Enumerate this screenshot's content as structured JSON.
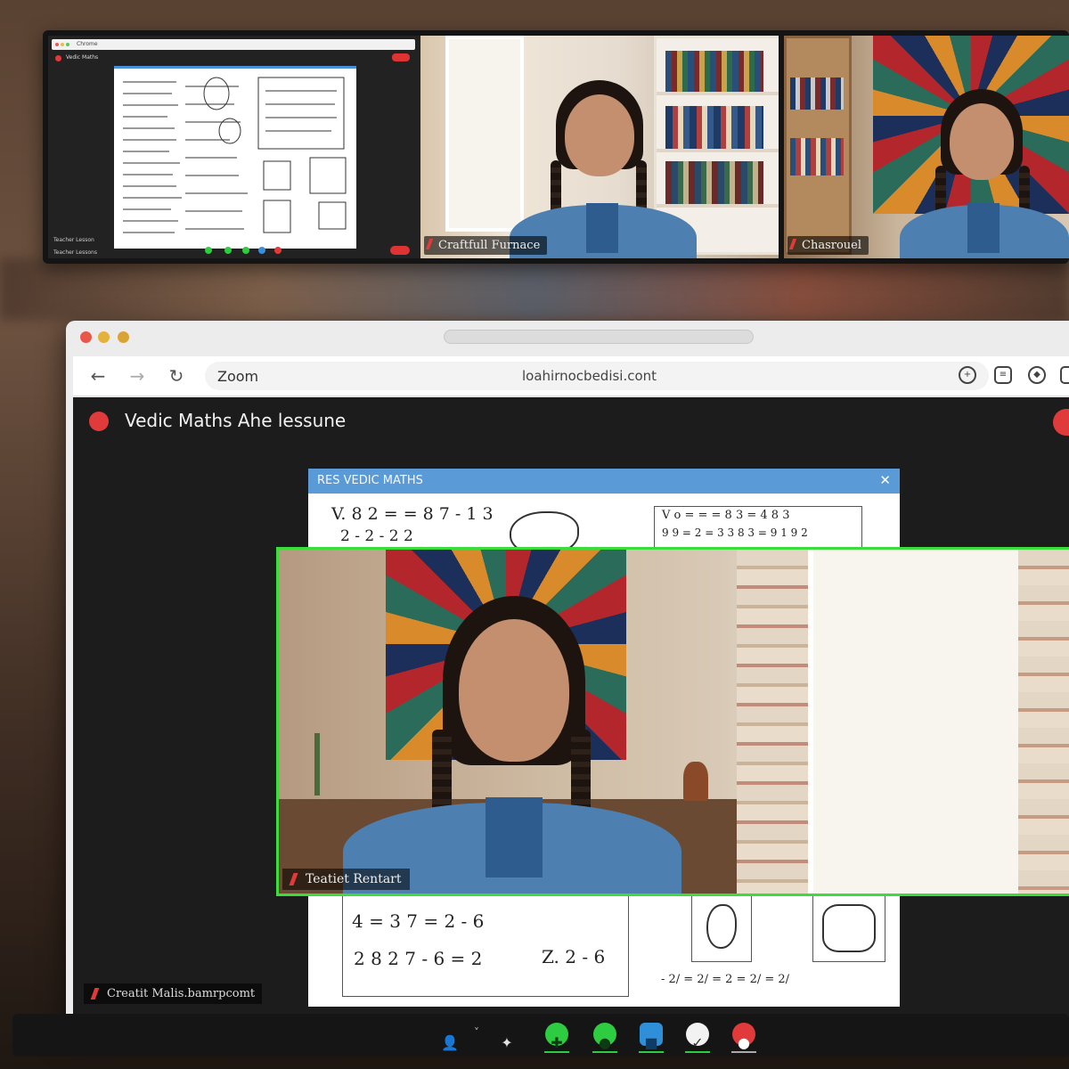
{
  "top_strip": {
    "shared_screen": {
      "url_text": "Chrome",
      "title": "Vedic Maths",
      "name_line1": "Teacher Lesson",
      "name_line2": "Teacher Lessons"
    },
    "tiles": [
      {
        "name": "Craftfull Furnace"
      },
      {
        "name": "Chasrouel"
      }
    ]
  },
  "browser": {
    "tab_text": "",
    "address_left": "Zoom",
    "address_center": "loahirnocbedisi.cont",
    "back_icon": "back-arrow-icon",
    "forward_icon": "forward-arrow-icon",
    "reload_icon": "reload-icon"
  },
  "meeting": {
    "title": "Vedic Maths Ahe lessune",
    "rec_color": "#e03a3a",
    "share_window_title": "RES   VEDIC MATHS",
    "math_lines": {
      "top_left": "V.  8 2 = = 8 7  - 1 3",
      "top_left2": "2       -    2 - 2 2",
      "top_right": "V o = = = 8 3 = 4  8 3",
      "top_right2": "9 9 = 2 = 3 3  8 3 = 9 1  9 2",
      "bottom_1": "4  = 3 7   = 2 - 6",
      "bottom_2": "2 8 2 7 - 6  = 2",
      "bottom_3": "Z. 2 - 6",
      "bottom_right": "- 2/ = 2/ = 2 = 2/ = 2/"
    },
    "spotlight_name": "Teatiet Rentart",
    "self_name": "Creatit Malis.bamrpcomt",
    "accent_green": "#3ddc3d"
  },
  "controls": [
    {
      "icon": "participants-icon",
      "glyph": "👤"
    },
    {
      "icon": "reactions-icon",
      "glyph": "✦"
    },
    {
      "icon": "grid-icon",
      "glyph": "✚"
    },
    {
      "icon": "chat-icon",
      "glyph": "●"
    },
    {
      "icon": "share-screen-icon",
      "glyph": "■"
    },
    {
      "icon": "check-icon",
      "glyph": "✓"
    },
    {
      "icon": "mic-icon",
      "glyph": "●"
    }
  ]
}
